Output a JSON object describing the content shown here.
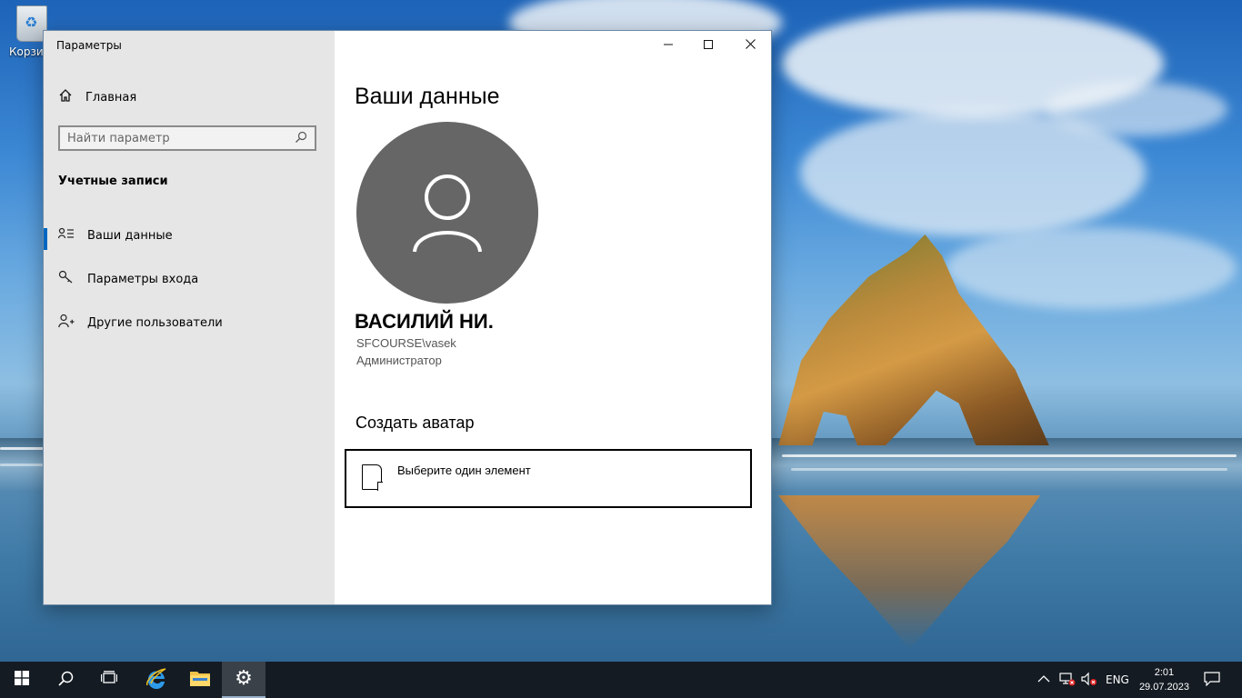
{
  "desktop": {
    "recycle_bin_label": "Корзина"
  },
  "window": {
    "title": "Параметры",
    "controls": {
      "minimize_icon": "minimize-icon",
      "maximize_icon": "maximize-icon",
      "close_icon": "close-icon"
    }
  },
  "sidebar": {
    "home_label": "Главная",
    "search_placeholder": "Найти параметр",
    "section_title": "Учетные записи",
    "items": [
      {
        "label": "Ваши данные",
        "icon": "user-info-icon",
        "active": true
      },
      {
        "label": "Параметры входа",
        "icon": "key-icon",
        "active": false
      },
      {
        "label": "Другие пользователи",
        "icon": "add-user-icon",
        "active": false
      }
    ]
  },
  "main": {
    "page_title": "Ваши данные",
    "user_name": "ВАСИЛИЙ НИ.",
    "user_login": "SFCOURSE\\vasek",
    "user_role": "Администратор",
    "avatar_section_title": "Создать аватар",
    "avatar_picker_label": "Выберите один элемент"
  },
  "taskbar": {
    "language": "ENG",
    "time": "2:01",
    "date": "29.07.2023"
  },
  "colors": {
    "accent": "#0067c0",
    "sidebar_bg": "#e6e6e6",
    "avatar_bg": "#666666",
    "taskbar_bg": "#141b23"
  }
}
